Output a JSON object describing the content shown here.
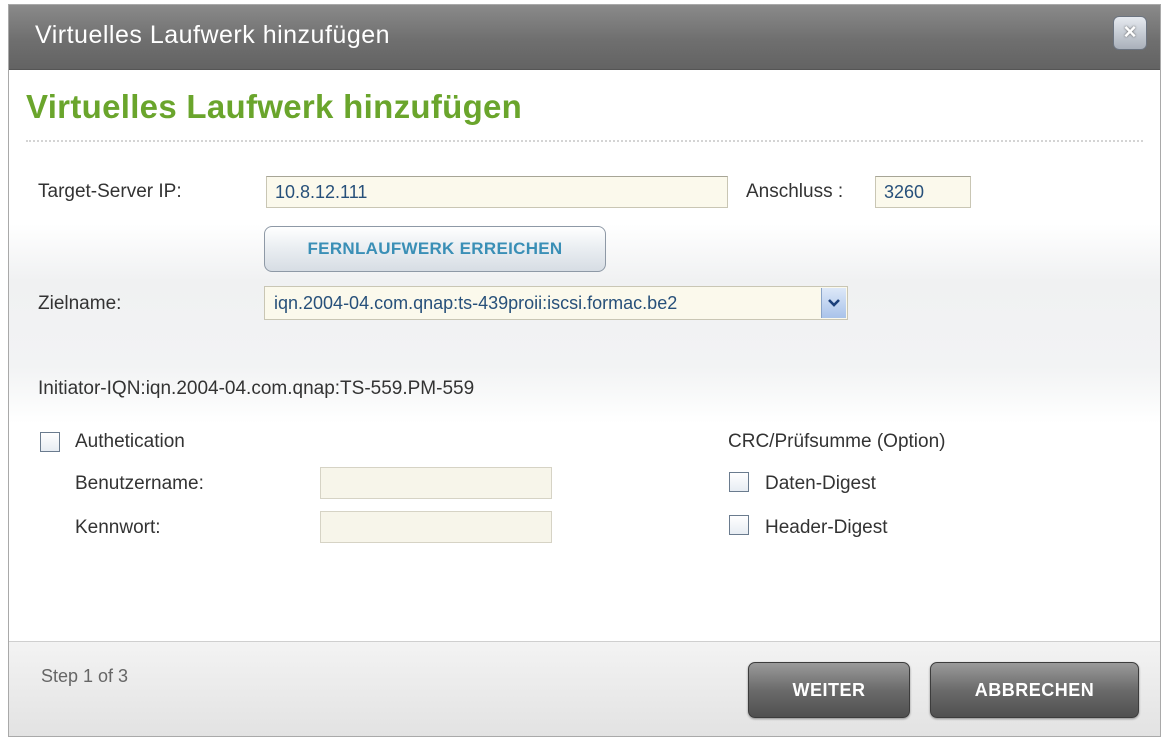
{
  "window": {
    "title": "Virtuelles Laufwerk hinzufügen",
    "close_glyph": "×"
  },
  "heading": "Virtuelles Laufwerk hinzufügen",
  "form": {
    "target_ip_label": "Target-Server IP:",
    "target_ip_value": "10.8.12.111",
    "port_label": "Anschluss :",
    "port_value": "3260",
    "remote_button_label": "FERNLAUFWERK ERREICHEN",
    "target_name_label": "Zielname:",
    "target_name_value": "iqn.2004-04.com.qnap:ts-439proii:iscsi.formac.be2",
    "initiator_iqn": "Initiator-IQN:iqn.2004-04.com.qnap:TS-559.PM-559",
    "auth_label": "Authetication",
    "auth_checked": false,
    "username_label": "Benutzername:",
    "username_value": "",
    "password_label": "Kennwort:",
    "password_value": "",
    "crc_label": "CRC/Prüfsumme (Option)",
    "data_digest_label": "Daten-Digest",
    "data_digest_checked": false,
    "header_digest_label": "Header-Digest",
    "header_digest_checked": false
  },
  "footer": {
    "step_text": "Step 1 of 3",
    "next_label": "WEITER",
    "cancel_label": "ABBRECHEN"
  },
  "colors": {
    "heading_green": "#6aa52c",
    "link_blue": "#3a8fb6",
    "input_background": "#fbf9ec",
    "titlebar_gray": "#7a7a7a"
  },
  "icons": {
    "close": "close-icon",
    "dropdown": "chevron-down-icon"
  }
}
